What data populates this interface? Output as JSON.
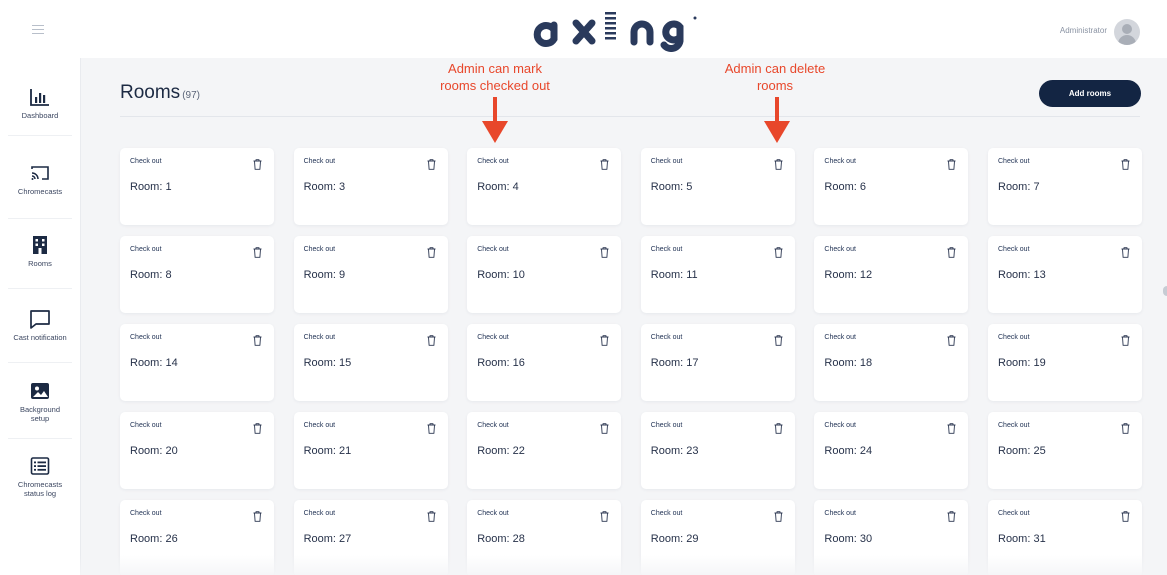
{
  "header": {
    "logo_text": "axing",
    "user_label": "Administrator"
  },
  "sidebar": {
    "items": [
      {
        "label": "Dashboard",
        "icon": "bar-chart-icon"
      },
      {
        "label": "Chromecasts",
        "icon": "cast-icon"
      },
      {
        "label": "Rooms",
        "icon": "building-icon"
      },
      {
        "label": "Cast notification",
        "icon": "message-icon"
      },
      {
        "label": "Background setup",
        "icon": "image-icon"
      },
      {
        "label": "Chromecasts status log",
        "icon": "list-icon"
      }
    ]
  },
  "main": {
    "title": "Rooms",
    "count": "(97)",
    "add_button": "Add rooms",
    "card_action": "Check out",
    "rooms": [
      "Room: 1",
      "Room: 3",
      "Room: 4",
      "Room: 5",
      "Room: 6",
      "Room: 7",
      "Room: 8",
      "Room: 9",
      "Room: 10",
      "Room: 11",
      "Room: 12",
      "Room: 13",
      "Room: 14",
      "Room: 15",
      "Room: 16",
      "Room: 17",
      "Room: 18",
      "Room: 19",
      "Room: 20",
      "Room: 21",
      "Room: 22",
      "Room: 23",
      "Room: 24",
      "Room: 25",
      "Room: 26",
      "Room: 27",
      "Room: 28",
      "Room: 29",
      "Room: 30",
      "Room: 31"
    ]
  },
  "annotations": {
    "mark_checked_out": [
      "Admin can mark",
      "rooms checked out"
    ],
    "delete_rooms": [
      "Admin can delete",
      "rooms"
    ],
    "color": "#e8472b"
  },
  "colors": {
    "primary": "#132543",
    "logo": "#2a3a5c",
    "background": "#f4f5f7"
  }
}
